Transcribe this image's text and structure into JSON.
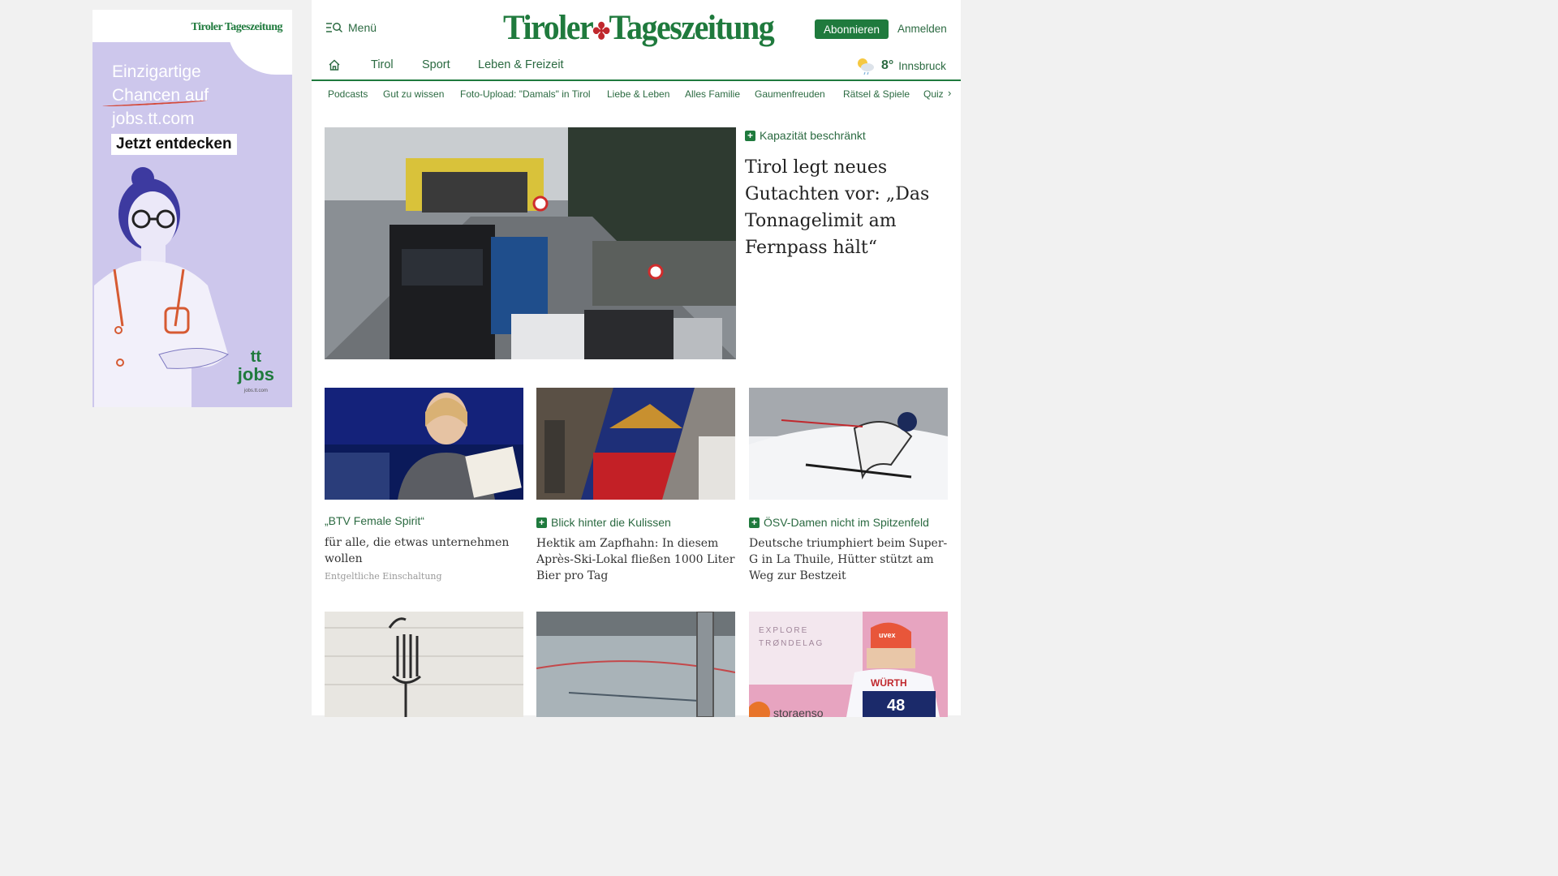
{
  "ad": {
    "logo": "Tiroler Tageszeitung",
    "headline_1": "Einzigartige",
    "headline_2": "Chancen auf",
    "headline_3": "jobs.tt.com",
    "cta": "Jetzt entdecken",
    "brand_tt": "tt",
    "brand_jobs": "jobs",
    "brand_url": "jobs.tt.com"
  },
  "header": {
    "menu_label": "Menü",
    "brand_left": "Tiroler",
    "brand_right": "Tageszeitung",
    "subscribe_label": "Abonnieren",
    "login_label": "Anmelden",
    "accent_color": "#1f7a3d"
  },
  "nav": {
    "items": [
      "Tirol",
      "Sport",
      "Leben & Freizeit"
    ],
    "weather_temp": "8°",
    "weather_city": "Innsbruck"
  },
  "subnav": {
    "items": [
      "Podcasts",
      "Gut zu wissen",
      "Foto-Upload: \"Damals\" in Tirol",
      "Liebe & Leben",
      "Alles Familie",
      "Gaumenfreuden",
      "Rätsel & Spiele",
      "Quiz"
    ]
  },
  "hero": {
    "kicker": "Kapazität beschränkt",
    "title": "Tirol legt neues Gutachten vor: „Das Tonnagelimit am Fernpass hält“"
  },
  "cards": [
    {
      "kicker": "„BTV Female Spirit“",
      "title": "für alle, die etwas unternehmen wollen",
      "note": "Entgeltliche Einschaltung"
    },
    {
      "kicker": "Blick hinter die Kulissen",
      "title": "Hektik am Zapfhahn: In diesem Après-Ski-Lokal fließen 1000 Liter Bier pro Tag"
    },
    {
      "kicker": "ÖSV-Damen nicht im Spitzenfeld",
      "title": "Deutsche triumphiert beim Super-G in La Thuile, Hütter stützt am Weg zur Bestzeit"
    }
  ],
  "row3": {
    "sign_text_1": "EXPLORE",
    "sign_text_2": "TRØNDELAG",
    "bib_sponsor": "WÜRTH",
    "bib_number": "48",
    "helmet_brand": "uvex",
    "banner_text": "storaenso"
  }
}
